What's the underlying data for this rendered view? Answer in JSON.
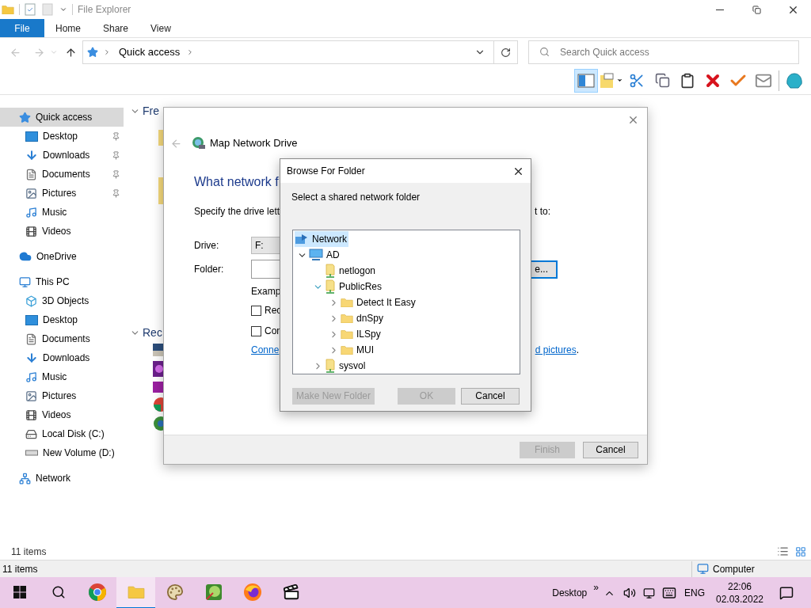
{
  "title_bar": {
    "title": "File Explorer"
  },
  "ribbon_tabs": [
    {
      "label": "File",
      "kind": "file"
    },
    {
      "label": "Home",
      "kind": "tab"
    },
    {
      "label": "Share",
      "kind": "tab"
    },
    {
      "label": "View",
      "kind": "tab"
    }
  ],
  "address_bar": {
    "path": "Quick access"
  },
  "search": {
    "placeholder": "Search Quick access"
  },
  "toolbar": [
    {
      "kind": "pane",
      "selected": true
    },
    {
      "kind": "note",
      "selected": false
    },
    {
      "kind": "cut",
      "selected": false
    },
    {
      "kind": "copy",
      "selected": false
    },
    {
      "kind": "paste",
      "selected": false
    },
    {
      "kind": "delete",
      "selected": false
    },
    {
      "kind": "check",
      "selected": false
    },
    {
      "kind": "mail",
      "selected": false
    },
    {
      "kind": "shell",
      "selected": false
    }
  ],
  "sidebar": {
    "items": [
      {
        "label": "Quick access",
        "kind": "quick_access",
        "selected": true,
        "children": [
          {
            "label": "Desktop",
            "kind": "desktop",
            "selected": false,
            "pinned": true
          },
          {
            "label": "Downloads",
            "kind": "downloads",
            "selected": false,
            "pinned": true
          },
          {
            "label": "Documents",
            "kind": "documents",
            "selected": false,
            "pinned": true
          },
          {
            "label": "Pictures",
            "kind": "pictures",
            "selected": false,
            "pinned": true
          },
          {
            "label": "Music",
            "kind": "music",
            "selected": false,
            "pinned": false
          },
          {
            "label": "Videos",
            "kind": "videos",
            "selected": false,
            "pinned": false
          }
        ]
      },
      {
        "label": "OneDrive",
        "kind": "onedrive",
        "selected": false
      },
      {
        "label": "This PC",
        "kind": "pc",
        "selected": false,
        "children": [
          {
            "label": "3D Objects",
            "kind": "objects",
            "selected": false
          },
          {
            "label": "Desktop",
            "kind": "desktop",
            "selected": false
          },
          {
            "label": "Documents",
            "kind": "documents",
            "selected": false
          },
          {
            "label": "Downloads",
            "kind": "downloads",
            "selected": false
          },
          {
            "label": "Music",
            "kind": "music",
            "selected": false
          },
          {
            "label": "Pictures",
            "kind": "pictures",
            "selected": false
          },
          {
            "label": "Videos",
            "kind": "videos",
            "selected": false
          },
          {
            "label": "Local Disk (C:)",
            "kind": "disk",
            "selected": false
          },
          {
            "label": "New Volume (D:)",
            "kind": "drive",
            "selected": false
          }
        ]
      },
      {
        "label": "Network",
        "kind": "network",
        "selected": false
      }
    ]
  },
  "content": {
    "sections": [
      {
        "title": "Fre",
        "kind": "folders"
      },
      {
        "title": "Rec",
        "kind": "files"
      }
    ]
  },
  "map_dialog": {
    "title": "Map Network Drive",
    "heading": "What network f",
    "instruction_left": "Specify the drive lett",
    "instruction_right": "t to:",
    "drive_label": "Drive:",
    "drive_value": "F:",
    "folder_label": "Folder:",
    "browse_button": "e...",
    "example": "Examp",
    "checkboxes": [
      {
        "label": "Rec",
        "checked": false
      },
      {
        "label": "Con",
        "checked": false
      }
    ],
    "link_left": "Conne",
    "link_right": "d pictures",
    "link_right_suffix": ".",
    "buttons": [
      {
        "label": "Finish",
        "disabled": true
      },
      {
        "label": "Cancel",
        "disabled": false
      }
    ]
  },
  "browse_dialog": {
    "title": "Browse For Folder",
    "prompt": "Select a shared network folder",
    "tree": [
      {
        "label": "Network",
        "kind": "network",
        "selected": true,
        "children": [
          {
            "label": "AD",
            "kind": "computer",
            "selected": false,
            "expanded": true,
            "children": [
              {
                "label": "netlogon",
                "kind": "share",
                "selected": false
              },
              {
                "label": "PublicRes",
                "kind": "share",
                "selected": false,
                "expanded": true,
                "children": [
                  {
                    "label": "Detect It Easy",
                    "kind": "folder",
                    "selected": false,
                    "expanded": false
                  },
                  {
                    "label": "dnSpy",
                    "kind": "folder",
                    "selected": false,
                    "expanded": false
                  },
                  {
                    "label": "ILSpy",
                    "kind": "folder",
                    "selected": false,
                    "expanded": false
                  },
                  {
                    "label": "MUI",
                    "kind": "folder",
                    "selected": false,
                    "expanded": false
                  }
                ]
              },
              {
                "label": "sysvol",
                "kind": "share",
                "selected": false,
                "expanded": false
              }
            ]
          }
        ]
      }
    ],
    "buttons": [
      {
        "label": "Make New Folder",
        "disabled": true
      },
      {
        "label": "OK",
        "disabled": true
      },
      {
        "label": "Cancel",
        "disabled": false
      }
    ]
  },
  "status_bar": {
    "text": "11 items"
  },
  "outer_status_bar": {
    "left": "11 items",
    "right": "Computer"
  },
  "taskbar": {
    "apps": [
      {
        "kind": "start",
        "selected": false
      },
      {
        "kind": "search",
        "selected": false
      },
      {
        "kind": "chrome",
        "selected": false
      },
      {
        "kind": "explorer",
        "selected": true
      },
      {
        "kind": "paint",
        "selected": false
      },
      {
        "kind": "map",
        "selected": false
      },
      {
        "kind": "firefox",
        "selected": false
      },
      {
        "kind": "clapper",
        "selected": false
      }
    ],
    "toolbar_label": "Desktop",
    "toolbar_chevron": "»",
    "language": "ENG",
    "time": "22:06",
    "date": "02.03.2022"
  }
}
